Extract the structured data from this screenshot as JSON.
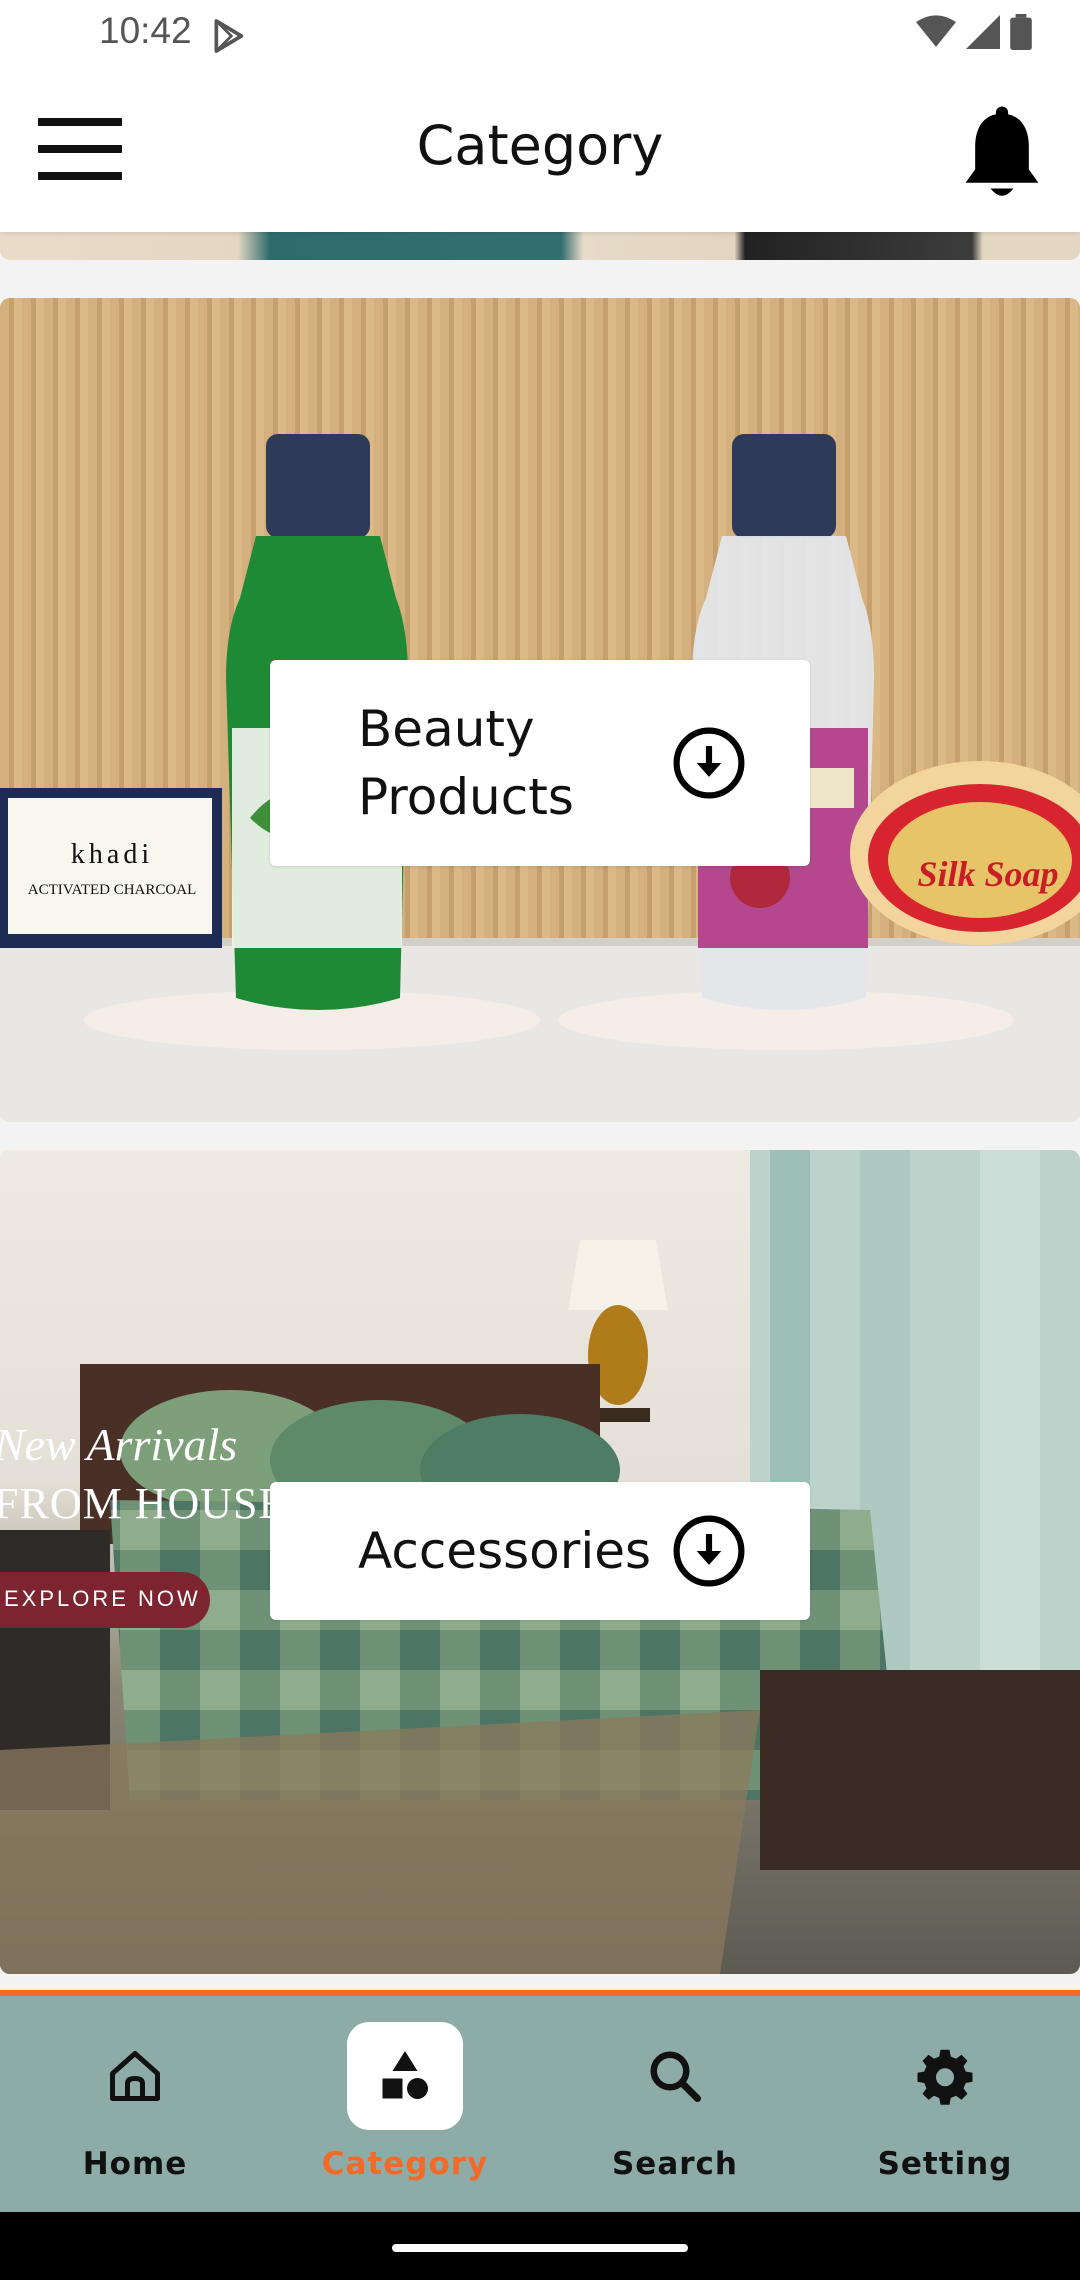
{
  "status_bar": {
    "time": "10:42"
  },
  "app_bar": {
    "title": "Category"
  },
  "categories": [
    {
      "label": "Beauty\nProducts",
      "image": "beauty-products-banner"
    },
    {
      "label": "Accessories",
      "image": "bedroom-banner"
    }
  ],
  "promo": {
    "line1": "New Arrivals",
    "line2": "FROM HOUSE TO HOME",
    "button": "EXPLORE NOW"
  },
  "product_labels": {
    "charcoal_brand": "khadi",
    "charcoal_name": "ACTIVATED CHARCOAL",
    "soap_name": "Silk Soap"
  },
  "bottom_nav": [
    {
      "label": "Home",
      "icon": "home-icon",
      "active": false
    },
    {
      "label": "Category",
      "icon": "category-icon",
      "active": true
    },
    {
      "label": "Search",
      "icon": "search-icon",
      "active": false
    },
    {
      "label": "Setting",
      "icon": "gear-icon",
      "active": false
    }
  ],
  "colors": {
    "accent": "#f26a28",
    "nav_bg": "#8eaca7"
  }
}
